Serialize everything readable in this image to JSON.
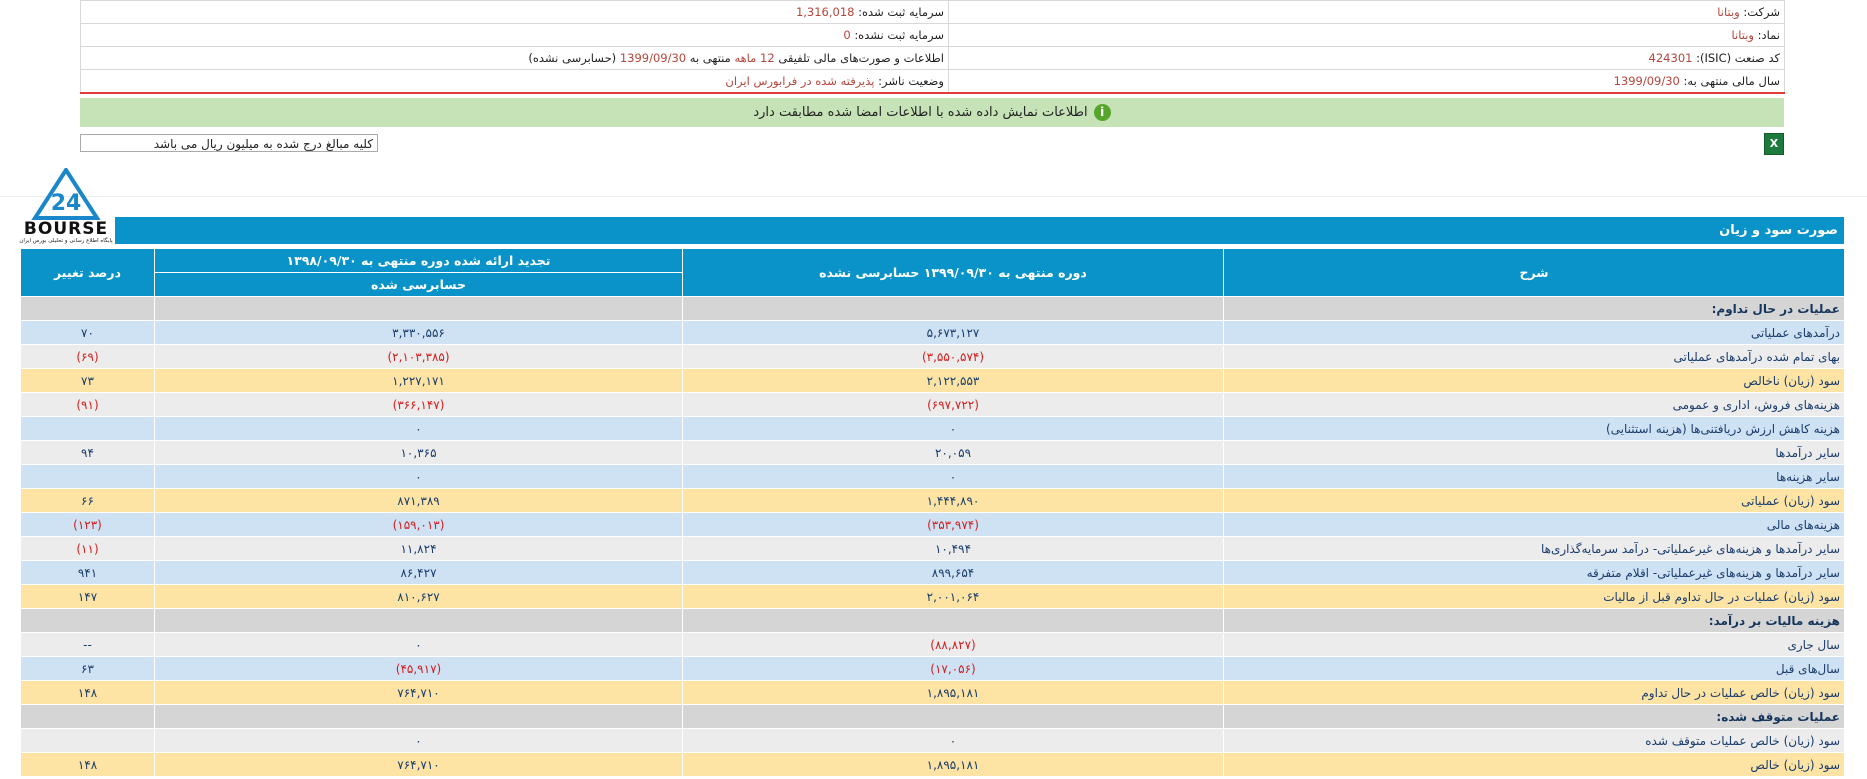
{
  "company_info": {
    "company_label": "شرکت:",
    "company_value": "وبتانا",
    "registered_capital_label": "سرمایه ثبت شده:",
    "registered_capital_value": "1,316,018",
    "symbol_label": "نماد:",
    "symbol_value": "وبتانا",
    "unregistered_capital_label": "سرمایه ثبت نشده:",
    "unregistered_capital_value": "0",
    "isic_label": "کد صنعت (ISIC):",
    "isic_value": "424301",
    "report_title_a": "اطلاعات و صورت‌های مالی تلفیقی",
    "report_period": "12 ماهه",
    "report_title_b": "منتهی به",
    "report_date": "1399/09/30",
    "report_status": "(حسابرسی نشده)",
    "fiscal_year_label": "سال مالی منتهی به:",
    "fiscal_year_value": "1399/09/30",
    "publisher_status_label": "وضعیت ناشر:",
    "publisher_status_value": "پذیرفته شده در فرابورس ایران"
  },
  "banner": {
    "text": "اطلاعات نمایش داده شده با اطلاعات امضا شده مطابقت دارد",
    "icon": "info-icon"
  },
  "unit_note": "کلیه مبالغ درج شده به میلیون ریال می باشد",
  "excel_icon": "excel-export-icon",
  "logo": {
    "number": "24",
    "name": "BOURSE",
    "tagline": "پایگاه اطلاع رسانی و تحلیلی بورس ایران"
  },
  "section_title": "صورت سود و زیان",
  "columns": {
    "desc": "شرح",
    "current": "دوره منتهی به ۱۳۹۹/۰۹/۳۰ حسابرسی نشده",
    "previous": "تجدید ارائه شده دوره منتهی به ۱۳۹۸/۰۹/۳۰",
    "previous_sub": "حسابرسی شده",
    "change": "درصد تغییر"
  },
  "rows": [
    {
      "label": "عملیات در حال تداوم:",
      "current": "",
      "previous": "",
      "change": "",
      "style": "head"
    },
    {
      "label": "درآمدهای عملیاتی",
      "current": "۵,۶۷۳,۱۲۷",
      "previous": "۳,۳۳۰,۵۵۶",
      "change": "۷۰",
      "style": "blue"
    },
    {
      "label": "بهای تمام شده درآمدهای عملیاتی",
      "current": "(۳,۵۵۰,۵۷۴)",
      "previous": "(۲,۱۰۳,۳۸۵)",
      "change": "(۶۹)",
      "style": "grey"
    },
    {
      "label": "سود (زیان) ناخالص",
      "current": "۲,۱۲۲,۵۵۳",
      "previous": "۱,۲۲۷,۱۷۱",
      "change": "۷۳",
      "style": "gold"
    },
    {
      "label": "هزینه‌های فروش، اداری و عمومی",
      "current": "(۶۹۷,۷۲۲)",
      "previous": "(۳۶۶,۱۴۷)",
      "change": "(۹۱)",
      "style": "grey"
    },
    {
      "label": "هزینه کاهش ارزش دریافتنی‌ها (هزینه استثنایی)",
      "current": "۰",
      "previous": "۰",
      "change": "",
      "style": "blue"
    },
    {
      "label": "سایر درآمدها",
      "current": "۲۰,۰۵۹",
      "previous": "۱۰,۳۶۵",
      "change": "۹۴",
      "style": "grey"
    },
    {
      "label": "سایر هزینه‌ها",
      "current": "۰",
      "previous": "۰",
      "change": "",
      "style": "blue"
    },
    {
      "label": "سود (زیان) عملیاتی",
      "current": "۱,۴۴۴,۸۹۰",
      "previous": "۸۷۱,۳۸۹",
      "change": "۶۶",
      "style": "gold"
    },
    {
      "label": "هزینه‌های مالی",
      "current": "(۳۵۳,۹۷۴)",
      "previous": "(۱۵۹,۰۱۳)",
      "change": "(۱۲۳)",
      "style": "blue"
    },
    {
      "label": "سایر درآمدها و هزینه‌های غیرعملیاتی- درآمد سرمایه‌گذاری‌ها",
      "current": "۱۰,۴۹۴",
      "previous": "۱۱,۸۲۴",
      "change": "(۱۱)",
      "style": "grey"
    },
    {
      "label": "سایر درآمدها و هزینه‌های غیرعملیاتی- اقلام متفرقه",
      "current": "۸۹۹,۶۵۴",
      "previous": "۸۶,۴۲۷",
      "change": "۹۴۱",
      "style": "blue"
    },
    {
      "label": "سود (زیان) عملیات در حال تداوم قبل از مالیات",
      "current": "۲,۰۰۱,۰۶۴",
      "previous": "۸۱۰,۶۲۷",
      "change": "۱۴۷",
      "style": "gold"
    },
    {
      "label": "هزینه مالیات بر درآمد:",
      "current": "",
      "previous": "",
      "change": "",
      "style": "head"
    },
    {
      "label": "سال جاری",
      "current": "(۸۸,۸۲۷)",
      "previous": "۰",
      "change": "--",
      "style": "grey"
    },
    {
      "label": "سال‌های قبل",
      "current": "(۱۷,۰۵۶)",
      "previous": "(۴۵,۹۱۷)",
      "change": "۶۳",
      "style": "blue"
    },
    {
      "label": "سود (زیان) خالص عملیات در حال تداوم",
      "current": "۱,۸۹۵,۱۸۱",
      "previous": "۷۶۴,۷۱۰",
      "change": "۱۴۸",
      "style": "gold"
    },
    {
      "label": "عملیات متوقف شده:",
      "current": "",
      "previous": "",
      "change": "",
      "style": "head"
    },
    {
      "label": "سود (زیان) خالص عملیات متوقف شده",
      "current": "۰",
      "previous": "۰",
      "change": "",
      "style": "grey"
    },
    {
      "label": "سود (زیان) خالص",
      "current": "۱,۸۹۵,۱۸۱",
      "previous": "۷۶۴,۷۱۰",
      "change": "۱۴۸",
      "style": "gold"
    }
  ]
}
